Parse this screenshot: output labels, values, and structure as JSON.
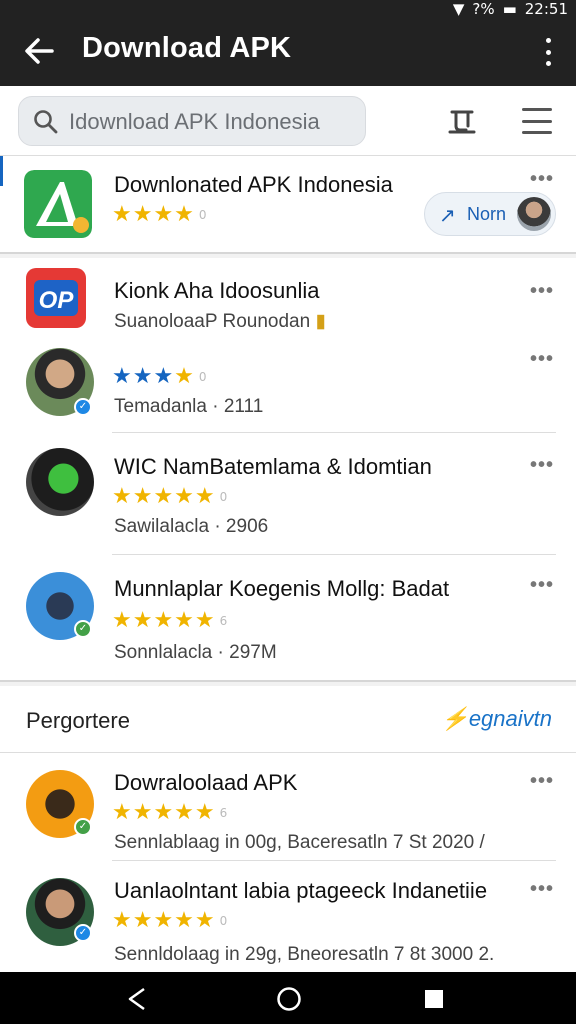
{
  "status": {
    "time": "22:51",
    "battery": "?%"
  },
  "appbar": {
    "title": "Download APK"
  },
  "search": {
    "placeholder": "Idownload APK Indonesia"
  },
  "featured": {
    "name": "Downlonated APK Indonesia",
    "stars": "★★★★",
    "count": "0",
    "now_label": "Norn"
  },
  "apps": [
    {
      "name": "Kionk Aha Idoosunlia",
      "sub": "SuanoloaaP Rounodan",
      "stars": "",
      "count": ""
    },
    {
      "name": "",
      "sub": "Temadanla · 2111",
      "stars": "★★★★",
      "count": "0"
    },
    {
      "name": "WIC NamBatemlama & Idomtian",
      "sub": "Sawilalacla · 2906",
      "stars": "★★★★★",
      "count": "0"
    },
    {
      "name": "Munnlaplar Koegenis Mollg: Badat",
      "sub": "Sonnlalacla · 297M",
      "stars": "★★★★★",
      "count": "6"
    }
  ],
  "section": {
    "title": "Pergortere",
    "link": "egnaivtn",
    "items": [
      {
        "name": "Dowraloolaad APK",
        "sub": "Sennlablaag in 00g, Baceresatln 7 St 2020 /",
        "stars": "★★★★★",
        "count": "6"
      },
      {
        "name": "Uanlaolntant labia ptageeck Indanetiie",
        "sub": "Sennldolaag in 29g, Bneoresatln 7 8t 3000 2.",
        "stars": "★★★★★",
        "count": "0"
      }
    ]
  },
  "colors": {
    "appbar": "#222222",
    "star": "#f0b400",
    "star_blue": "#1565c0",
    "link": "#1a73c8"
  }
}
